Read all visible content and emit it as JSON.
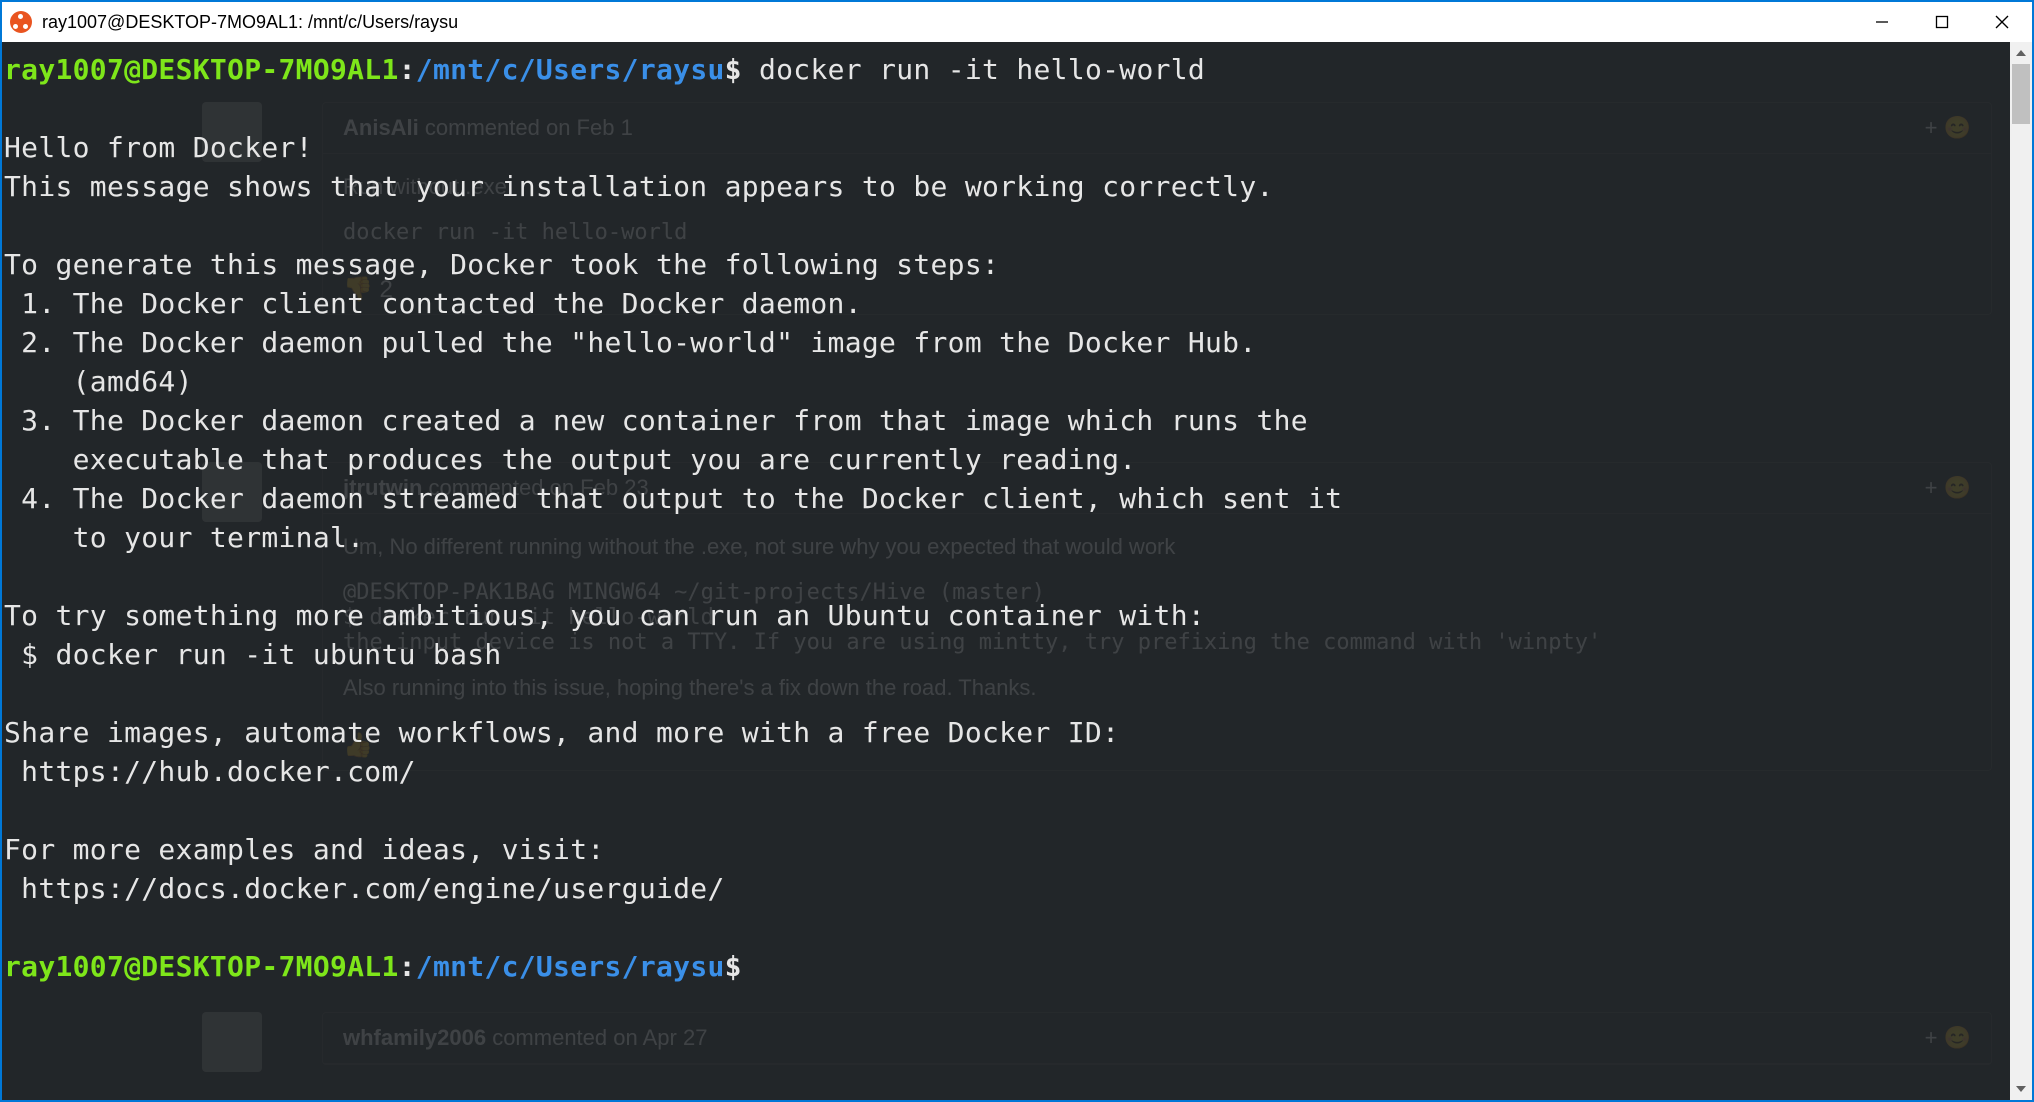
{
  "window": {
    "title": "ray1007@DESKTOP-7MO9AL1: /mnt/c/Users/raysu"
  },
  "prompt": {
    "user_host": "ray1007@DESKTOP-7MO9AL1",
    "colon": ":",
    "path": "/mnt/c/Users/raysu",
    "dollar": "$"
  },
  "command": "docker run -it hello-world",
  "output_lines": [
    "",
    "Hello from Docker!",
    "This message shows that your installation appears to be working correctly.",
    "",
    "To generate this message, Docker took the following steps:",
    " 1. The Docker client contacted the Docker daemon.",
    " 2. The Docker daemon pulled the \"hello-world\" image from the Docker Hub.",
    "    (amd64)",
    " 3. The Docker daemon created a new container from that image which runs the",
    "    executable that produces the output you are currently reading.",
    " 4. The Docker daemon streamed that output to the Docker client, which sent it",
    "    to your terminal.",
    "",
    "To try something more ambitious, you can run an Ubuntu container with:",
    " $ docker run -it ubuntu bash",
    "",
    "Share images, automate workflows, and more with a free Docker ID:",
    " https://hub.docker.com/",
    "",
    "For more examples and ideas, visit:",
    " https://docs.docker.com/engine/userguide/",
    ""
  ],
  "ghost": {
    "c1": {
      "author": "AnisAli",
      "meta": " commented on Feb 1",
      "body1": "Run without .exe",
      "body2": "docker run -it hello-world",
      "react": "👎  2"
    },
    "c2": {
      "author": "jtrutwin",
      "meta": " commented on Feb 23",
      "body1": "Um, No different running without the .exe, not sure why you expected that would work",
      "body2": "        @DESKTOP-PAK1BAG MINGW64 ~/git-projects/Hive (master)",
      "body3": "$ docker run -it hello-world",
      "body4": "the input device is not a TTY. If you are using mintty, try prefixing the command with 'winpty'",
      "body5": "Also running into this issue, hoping there's a fix down the road. Thanks.",
      "react": "👍"
    },
    "c3": {
      "author": "whfamily2006",
      "meta": " commented on Apr 27"
    },
    "emoji": "+ 😊"
  }
}
